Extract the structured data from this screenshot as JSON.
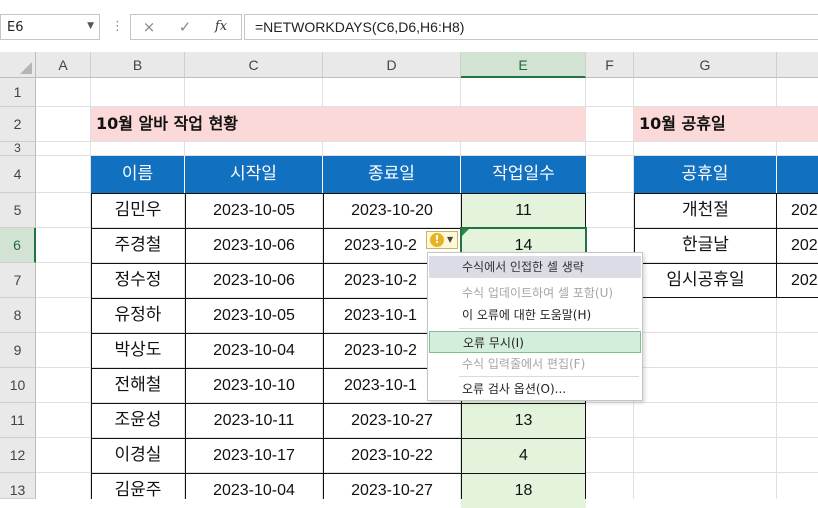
{
  "formula_bar": {
    "name_box": "E6",
    "cancel_icon": "×",
    "enter_icon": "✓",
    "fx_label": "fx",
    "formula": "=NETWORKDAYS(C6,D6,H6:H8)"
  },
  "columns": [
    "A",
    "B",
    "C",
    "D",
    "E",
    "F",
    "G"
  ],
  "rows": [
    "1",
    "2",
    "3",
    "4",
    "5",
    "6",
    "7",
    "8",
    "9",
    "10",
    "11",
    "12",
    "13"
  ],
  "work_table": {
    "title": "10월 알바 작업 현황",
    "headers": [
      "이름",
      "시작일",
      "종료일",
      "작업일수"
    ],
    "rows": [
      [
        "김민우",
        "2023-10-05",
        "2023-10-20",
        "11"
      ],
      [
        "주경철",
        "2023-10-06",
        "2023-10-2",
        "14"
      ],
      [
        "정수정",
        "2023-10-06",
        "2023-10-2",
        ""
      ],
      [
        "유정하",
        "2023-10-05",
        "2023-10-1",
        ""
      ],
      [
        "박상도",
        "2023-10-04",
        "2023-10-2",
        ""
      ],
      [
        "전해철",
        "2023-10-10",
        "2023-10-1",
        ""
      ],
      [
        "조윤성",
        "2023-10-11",
        "2023-10-27",
        "13"
      ],
      [
        "이경실",
        "2023-10-17",
        "2023-10-22",
        "4"
      ],
      [
        "김윤주",
        "2023-10-04",
        "2023-10-27",
        "18"
      ]
    ]
  },
  "holiday_table": {
    "title": "10월 공휴일",
    "header": "공휴일",
    "names": [
      "개천절",
      "한글날",
      "임시공휴일"
    ],
    "cut_values": [
      "202",
      "202",
      "202"
    ]
  },
  "error_menu": {
    "header": "수식에서 인접한 셀 생략",
    "items": [
      {
        "label": "수식 업데이트하여 셀 포함(U)",
        "disabled": true
      },
      {
        "label": "이 오류에 대한 도움말(H)",
        "disabled": false
      },
      {
        "label": "오류 무시(I)",
        "disabled": false,
        "highlighted": true
      },
      {
        "label": "수식 입력줄에서 편집(F)",
        "disabled": true
      },
      {
        "label": "오류 검사 옵션(O)...",
        "disabled": false
      }
    ]
  },
  "colors": {
    "accent_green": "#217346",
    "header_blue": "#1170c0",
    "title_pink": "#fcd9d9",
    "result_green": "#e4f4dc"
  }
}
